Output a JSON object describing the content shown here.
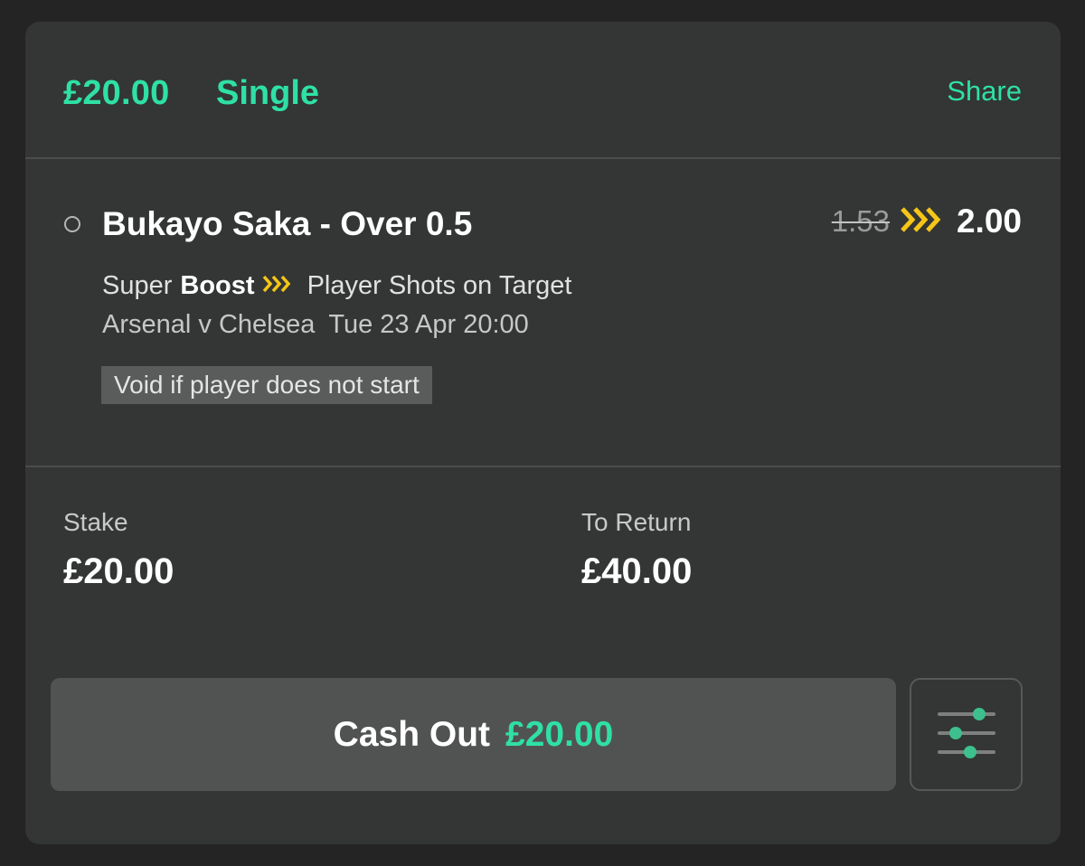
{
  "header": {
    "amount": "£20.00",
    "bet_type": "Single",
    "share_label": "Share"
  },
  "selection": {
    "name": "Bukayo Saka - Over 0.5",
    "old_odds": "1.53",
    "new_odds": "2.00",
    "boost_prefix": "Super",
    "boost_label": "Boost",
    "market": "Player Shots on Target",
    "event": "Arsenal v Chelsea",
    "datetime": "Tue 23 Apr 20:00",
    "note": "Void if player does not start"
  },
  "totals": {
    "stake_label": "Stake",
    "stake_value": "£20.00",
    "return_label": "To Return",
    "return_value": "£40.00"
  },
  "cashout": {
    "label": "Cash Out",
    "amount": "£20.00"
  },
  "icons": {
    "boost": "boost-arrows-icon",
    "settings": "sliders-icon",
    "selection": "selection-circle-icon"
  },
  "colors": {
    "accent": "#2fe0a6",
    "boost": "#f5c518",
    "card_bg": "#333634",
    "button_bg": "#515352"
  }
}
